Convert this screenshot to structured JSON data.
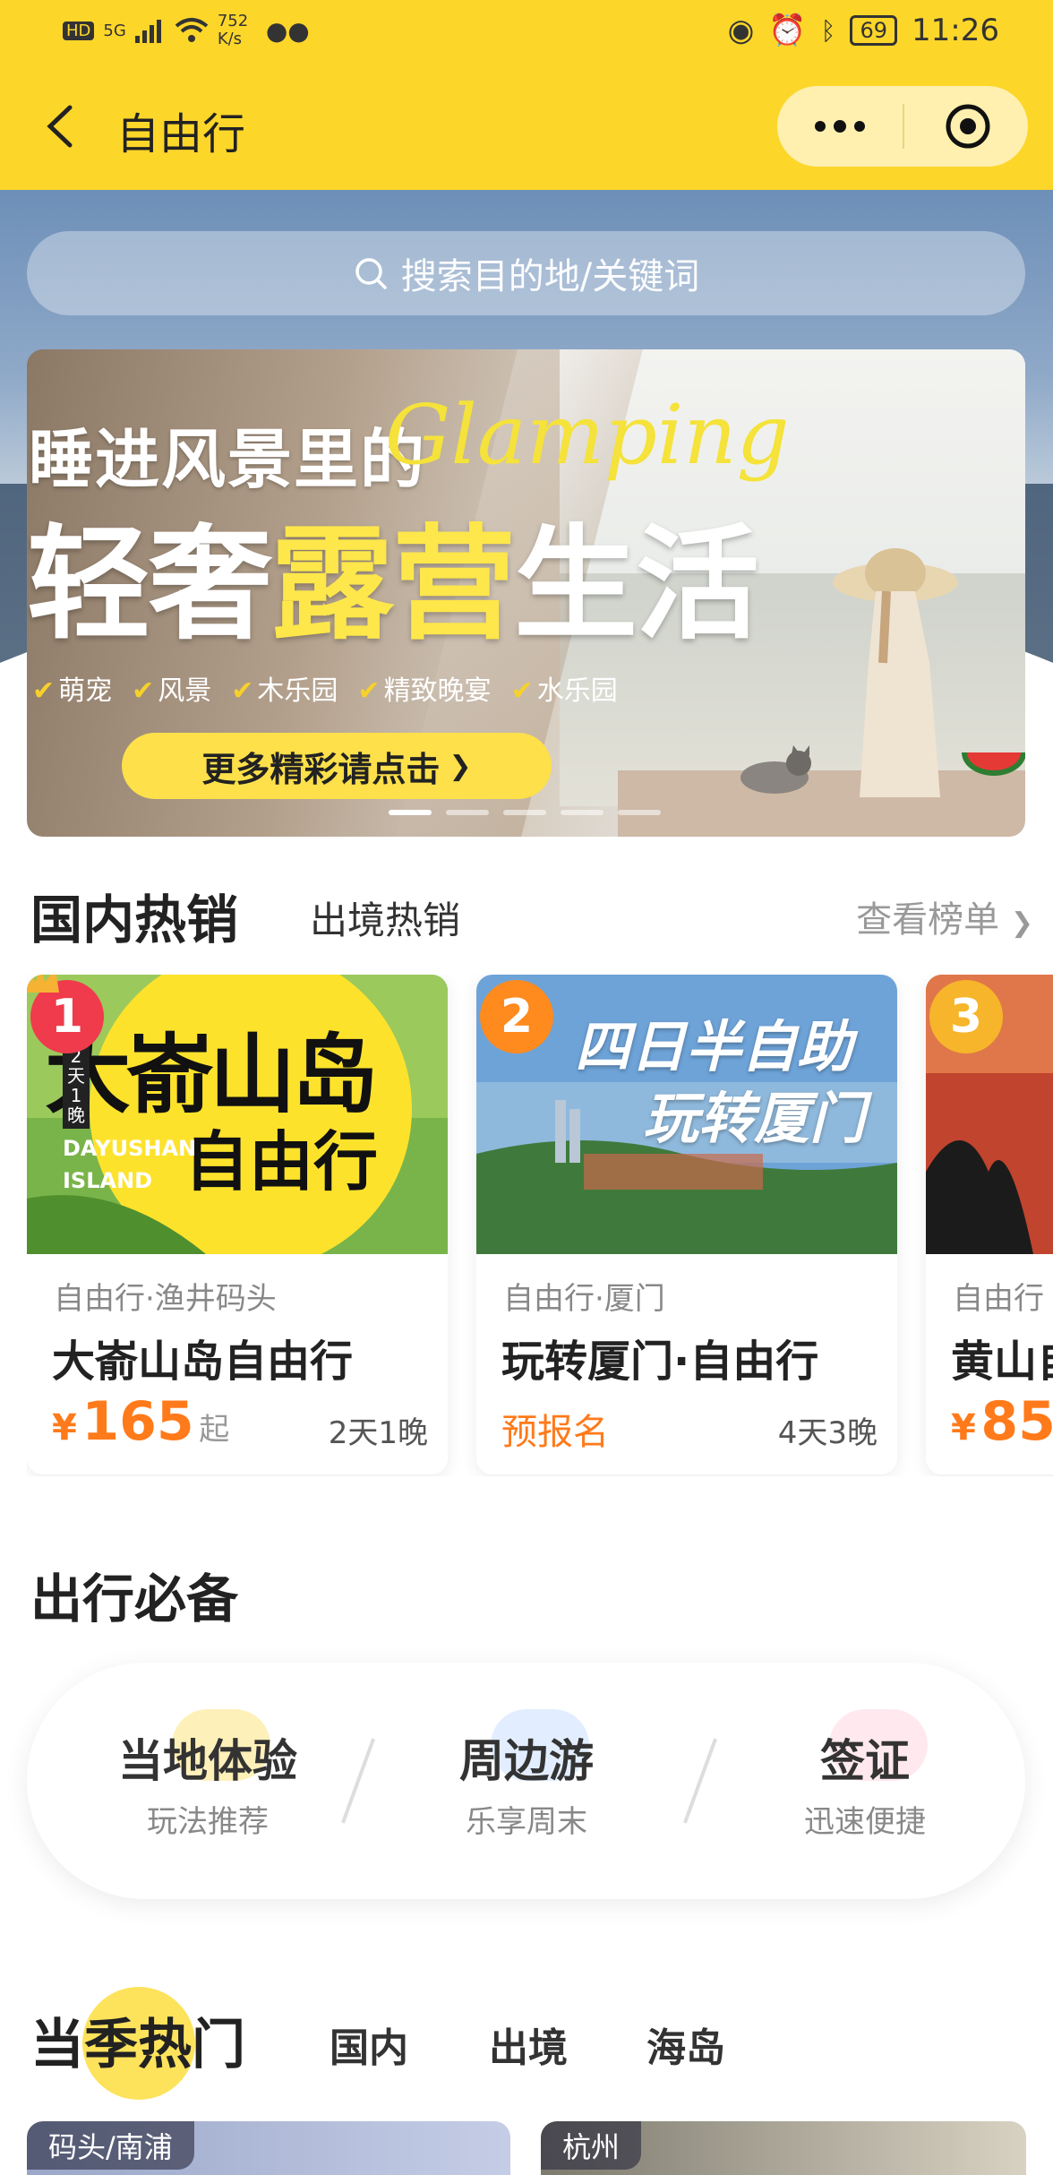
{
  "status_bar": {
    "left": [
      "HD",
      "5G",
      "752 K/s"
    ],
    "battery": "69",
    "time": "11:26"
  },
  "title_bar": {
    "title": "自由行"
  },
  "search": {
    "placeholder": "搜索目的地/关键词"
  },
  "banner": {
    "line1": "睡进风景里的",
    "script": "Glamping",
    "line2_a": "轻奢",
    "line2_b": "露营",
    "line2_c": "生活",
    "tags": [
      "萌宠",
      "风景",
      "木乐园",
      "精致晚宴",
      "水乐园"
    ],
    "button": "更多精彩请点击",
    "slides": 5,
    "active_slide": 0
  },
  "hot_sales": {
    "tab_domestic": "国内热销",
    "tab_outbound": "出境热销",
    "see_all": "查看榜单",
    "cards": [
      {
        "rank": "1",
        "image_title": "大嵛山岛",
        "image_sub": "自由行",
        "image_en": "DAYUSHAN ISLAND",
        "image_badge": "2天1晚",
        "category": "自由行·渔井码头",
        "name": "大嵛山岛自由行",
        "price_yen": "¥",
        "price": "165",
        "price_suffix": "起",
        "nights": "2天1晚"
      },
      {
        "rank": "2",
        "image_title": "四日半自助",
        "image_sub": "玩转厦门",
        "category": "自由行·厦门",
        "name": "玩转厦门·自由行",
        "presale": "预报名",
        "nights": "4天3晚"
      },
      {
        "rank": "3",
        "category": "自由行",
        "name": "黄山自",
        "price_yen": "¥",
        "price": "85"
      }
    ]
  },
  "essentials": {
    "title": "出行必备",
    "items": [
      {
        "main": "当地体验",
        "sub": "玩法推荐"
      },
      {
        "main": "周边游",
        "sub": "乐享周末"
      },
      {
        "main": "签证",
        "sub": "迅速便捷"
      }
    ]
  },
  "seasonal": {
    "title": "当季热门",
    "tabs": [
      "国内",
      "出境",
      "海岛"
    ],
    "cards": [
      "码头/南浦",
      "杭州"
    ]
  }
}
